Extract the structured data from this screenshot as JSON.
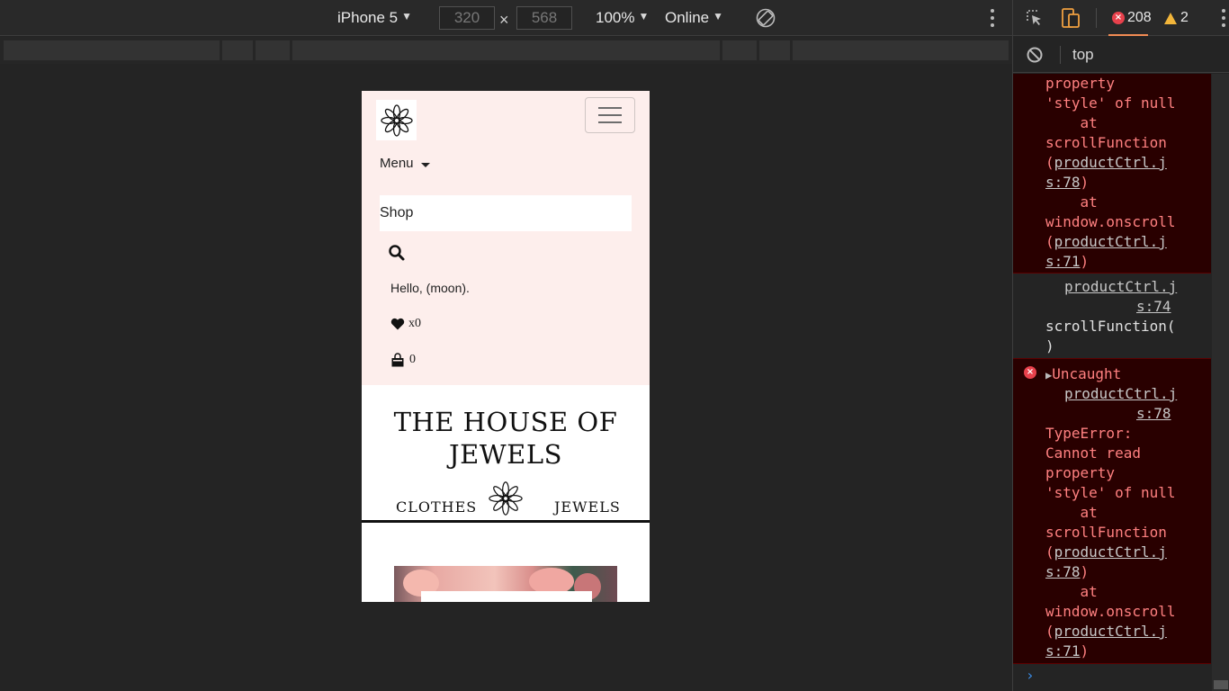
{
  "device_toolbar": {
    "device": "iPhone 5",
    "width": "320",
    "height": "568",
    "times": "×",
    "zoom": "100%",
    "throttle": "Online"
  },
  "site": {
    "menu_label": "Menu",
    "search_value": "Shop",
    "greeting": "Hello, (moon).",
    "wishlist_count": "x0",
    "bag_count": "0",
    "title": "THE HOUSE OF JEWELS",
    "nav_left": "CLOTHES",
    "nav_right": "JEWELS"
  },
  "devtools": {
    "error_count": "208",
    "warning_count": "2",
    "context": "top",
    "log": {
      "e1": [
        "property",
        "'style' of null",
        "    at",
        "scrollFunction",
        "(",
        "productCtrl.j",
        "s:78",
        ")",
        "    at",
        "window.onscroll",
        "(",
        "productCtrl.j",
        "s:71",
        ")"
      ],
      "p1": [
        "productCtrl.j",
        "s:74",
        "scrollFunction(",
        ")"
      ],
      "e2": [
        "Uncaught",
        "productCtrl.j",
        "s:78",
        "TypeError:",
        "Cannot read",
        "property",
        "'style' of null",
        "    at",
        "scrollFunction",
        "(",
        "productCtrl.j",
        "s:78",
        ")",
        "    at",
        "window.onscroll",
        "(",
        "productCtrl.j",
        "s:71",
        ")"
      ]
    },
    "prompt": "›"
  }
}
